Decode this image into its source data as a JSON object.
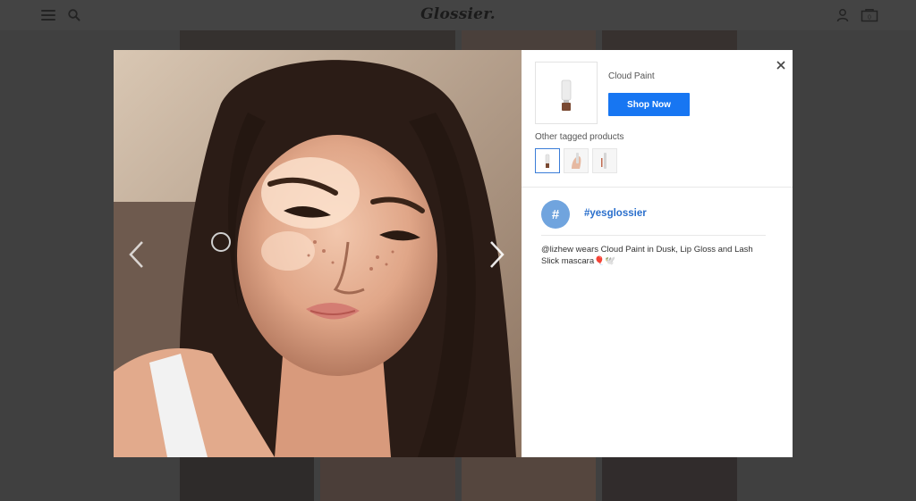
{
  "header": {
    "logo": "Glossier.",
    "icons": [
      "menu-icon",
      "search-icon",
      "account-icon",
      "bag-icon"
    ],
    "bag_count": "0"
  },
  "modal": {
    "photo_icon": "portrait-photo",
    "product": {
      "name": "Cloud Paint",
      "shop_label": "Shop Now"
    },
    "other_products_label": "Other tagged products",
    "thumbnails": [
      "cloud-paint-tube",
      "lip-gloss-hand",
      "lash-slick-mascara"
    ],
    "hashtag_symbol": "#",
    "hashtag": "#yesglossier",
    "caption": "@lizhew wears Cloud Paint in Dusk, Lip Gloss and Lash Slick mascara🎈🕊️"
  },
  "colors": {
    "accent": "#1776f2",
    "hashtag_badge": "#70a4de",
    "hashtag_text": "#2a6fcc",
    "overlay": "#4a4a4a"
  }
}
